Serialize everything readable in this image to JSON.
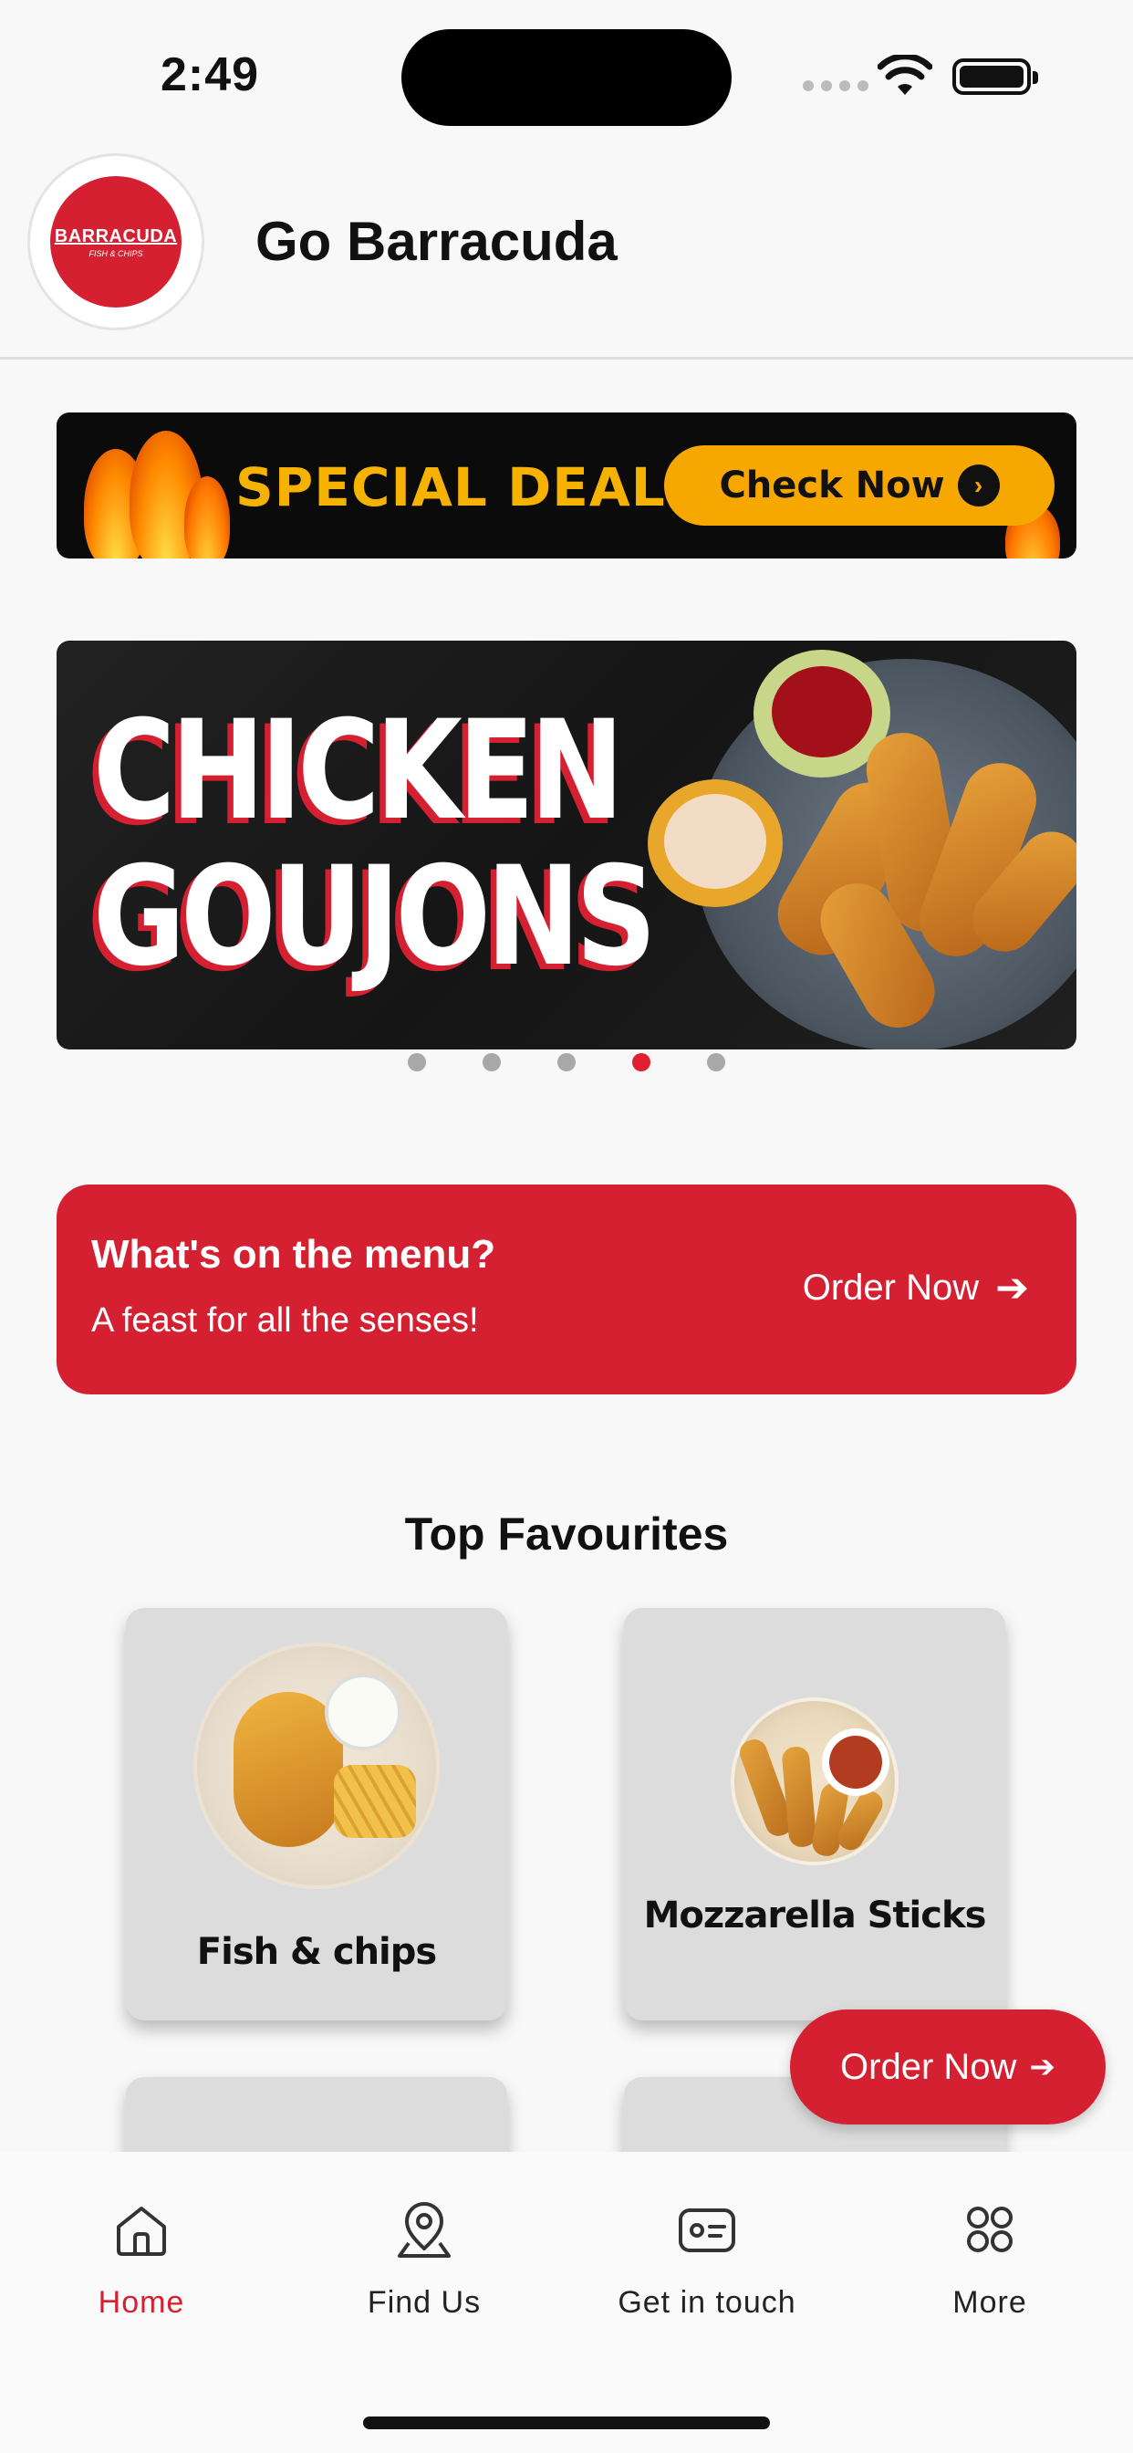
{
  "status_bar": {
    "time": "2:49"
  },
  "header": {
    "title": "Go Barracuda",
    "logo_text": "BARRACUDA",
    "logo_subtext": "FISH & CHIPS"
  },
  "deals_banner": {
    "text": "SPECIAL DEALS",
    "button_label": "Check Now"
  },
  "carousel": {
    "line1": "CHICKEN",
    "line2": "GOUJONS",
    "slide_count": 5,
    "active_index": 3
  },
  "menu_card": {
    "title": "What's on the menu?",
    "subtitle": "A feast for all the senses!",
    "action_label": "Order Now"
  },
  "favourites": {
    "title": "Top Favourites",
    "items": [
      {
        "label": "Fish & chips"
      },
      {
        "label": "Mozzarella Sticks"
      }
    ]
  },
  "fab": {
    "label": "Order Now"
  },
  "tabbar": {
    "items": [
      {
        "label": "Home",
        "icon": "home-icon",
        "active": true
      },
      {
        "label": "Find Us",
        "icon": "location-pin-icon",
        "active": false
      },
      {
        "label": "Get in touch",
        "icon": "contact-card-icon",
        "active": false
      },
      {
        "label": "More",
        "icon": "grid-icon",
        "active": false
      }
    ]
  },
  "colors": {
    "brand_red": "#d42030",
    "deals_orange": "#f7a800",
    "inactive_dot": "#a8a8a8"
  }
}
